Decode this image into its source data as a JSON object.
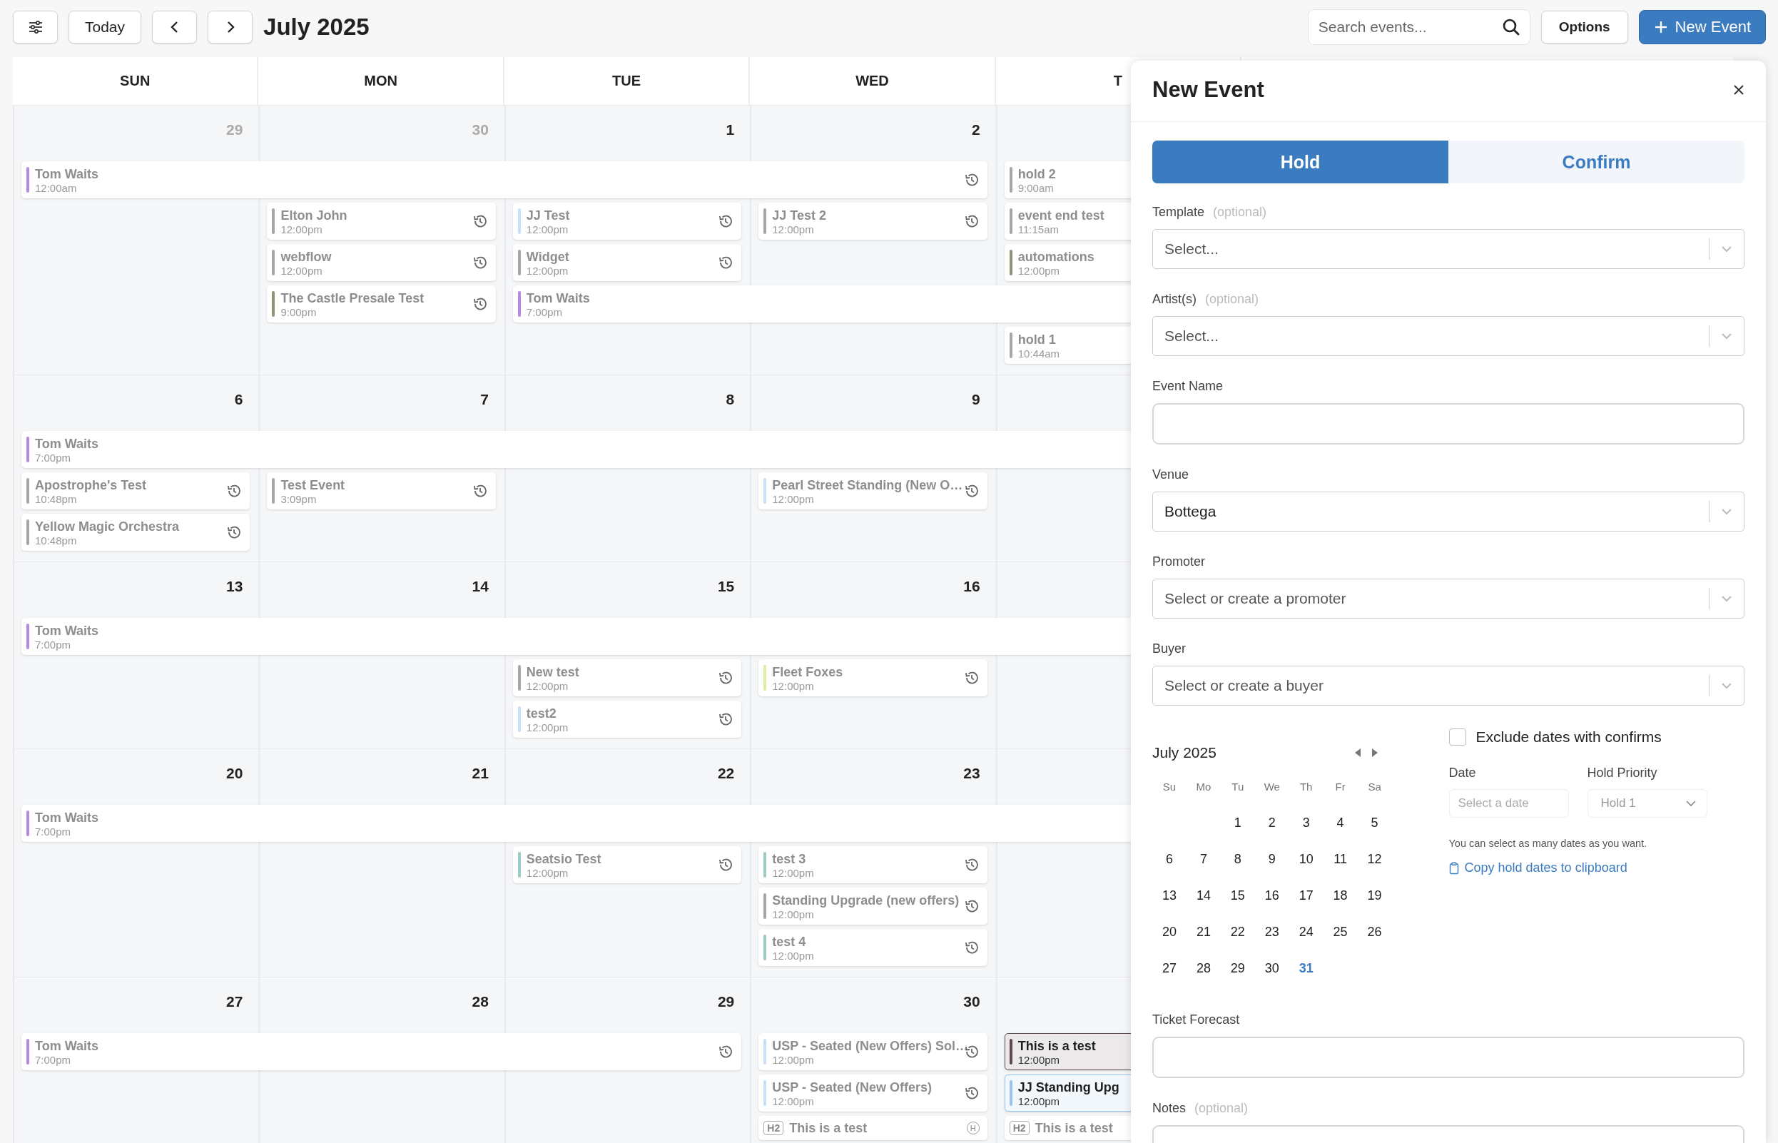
{
  "toolbar": {
    "today": "Today",
    "title": "July 2025",
    "search": {
      "placeholder": "Search events..."
    },
    "options": "Options",
    "new_event": "New Event"
  },
  "calendar": {
    "weekdays": [
      "SUN",
      "MON",
      "TUE",
      "WED",
      "T"
    ],
    "weeks": [
      {
        "days": [
          {
            "date": "29",
            "in_month": false
          },
          {
            "date": "30",
            "in_month": false
          },
          {
            "date": "1",
            "in_month": true
          },
          {
            "date": "2",
            "in_month": true
          }
        ],
        "lanes": [
          [
            {
              "kind": "hold",
              "title": "Tom Waits",
              "time": "12:00am",
              "color": "#b48be0",
              "history": true
            },
            {
              "kind": "continued"
            },
            {
              "kind": "continued"
            },
            {
              "kind": "continued"
            },
            {
              "kind": "hold",
              "title": "hold 2",
              "time": "9:00am",
              "color": "#a9a4a6",
              "history": false
            }
          ],
          [
            {
              "kind": "gap"
            },
            {
              "kind": "hold",
              "title": "Elton John",
              "time": "12:00pm",
              "color": "#a9a4a6",
              "history": true
            },
            {
              "kind": "hold",
              "title": "JJ Test",
              "time": "12:00pm",
              "color": "#c9defa",
              "history": true
            },
            {
              "kind": "hold",
              "title": "JJ Test 2",
              "time": "12:00pm",
              "color": "#a9a4a6",
              "history": true
            },
            {
              "kind": "hold",
              "title": "event end test",
              "time": "11:15am",
              "color": "#a9a4a6",
              "history": false
            }
          ],
          [
            {
              "kind": "gap"
            },
            {
              "kind": "hold",
              "title": "webflow",
              "time": "12:00pm",
              "color": "#a9a4a6",
              "history": true
            },
            {
              "kind": "hold",
              "title": "Widget",
              "time": "12:00pm",
              "color": "#a9a4a6",
              "history": true
            },
            {
              "kind": "gap"
            },
            {
              "kind": "hold",
              "title": "automations",
              "time": "12:00pm",
              "color": "#8f9474",
              "history": false
            }
          ],
          [
            {
              "kind": "gap"
            },
            {
              "kind": "hold",
              "title": "The Castle Presale Test",
              "time": "9:00pm",
              "color": "#8f9474",
              "history": true
            },
            {
              "kind": "hold",
              "title": "Tom Waits",
              "time": "7:00pm",
              "color": "#b48be0",
              "history": false
            },
            {
              "kind": "continued"
            },
            {
              "kind": "continued"
            },
            {
              "kind": "continued"
            },
            {
              "kind": "continued"
            }
          ],
          [
            {
              "kind": "gap"
            },
            {
              "kind": "gap"
            },
            {
              "kind": "gap"
            },
            {
              "kind": "gap"
            },
            {
              "kind": "hold",
              "title": "hold 1",
              "time": "10:44am",
              "color": "#a9a4a6",
              "history": false
            }
          ]
        ]
      },
      {
        "days": [
          {
            "date": "6",
            "in_month": true
          },
          {
            "date": "7",
            "in_month": true
          },
          {
            "date": "8",
            "in_month": true
          },
          {
            "date": "9",
            "in_month": true
          }
        ],
        "lanes": [
          [
            {
              "kind": "hold",
              "title": "Tom Waits",
              "time": "7:00pm",
              "color": "#b48be0",
              "history": false
            },
            {
              "kind": "continued"
            },
            {
              "kind": "continued"
            },
            {
              "kind": "continued"
            },
            {
              "kind": "continued"
            },
            {
              "kind": "continued"
            },
            {
              "kind": "continued"
            }
          ],
          [
            {
              "kind": "hold",
              "title": "Apostrophe's Test",
              "time": "10:48pm",
              "color": "#a9a4a6",
              "history": true
            },
            {
              "kind": "hold",
              "title": "Test Event",
              "time": "3:09pm",
              "color": "#a9a4a6",
              "history": true
            },
            {
              "kind": "gap"
            },
            {
              "kind": "hold",
              "title": "Pearl Street Standing (New O…",
              "time": "12:00pm",
              "color": "#c9defa",
              "history": true
            }
          ],
          [
            {
              "kind": "hold",
              "title": "Yellow Magic Orchestra",
              "time": "10:48pm",
              "color": "#a9a4a6",
              "history": true
            }
          ]
        ]
      },
      {
        "days": [
          {
            "date": "13",
            "in_month": true
          },
          {
            "date": "14",
            "in_month": true
          },
          {
            "date": "15",
            "in_month": true
          },
          {
            "date": "16",
            "in_month": true
          }
        ],
        "lanes": [
          [
            {
              "kind": "hold",
              "title": "Tom Waits",
              "time": "7:00pm",
              "color": "#b48be0",
              "history": false
            },
            {
              "kind": "continued"
            },
            {
              "kind": "continued"
            },
            {
              "kind": "continued"
            },
            {
              "kind": "continued"
            },
            {
              "kind": "continued"
            },
            {
              "kind": "continued"
            }
          ],
          [
            {
              "kind": "gap"
            },
            {
              "kind": "gap"
            },
            {
              "kind": "hold",
              "title": "New test",
              "time": "12:00pm",
              "color": "#a9a4a6",
              "history": true
            },
            {
              "kind": "hold",
              "title": "Fleet Foxes",
              "time": "12:00pm",
              "color": "#d8f0a0",
              "history": true
            }
          ],
          [
            {
              "kind": "gap"
            },
            {
              "kind": "gap"
            },
            {
              "kind": "hold",
              "title": "test2",
              "time": "12:00pm",
              "color": "#c9defa",
              "history": true
            }
          ]
        ]
      },
      {
        "days": [
          {
            "date": "20",
            "in_month": true
          },
          {
            "date": "21",
            "in_month": true
          },
          {
            "date": "22",
            "in_month": true
          },
          {
            "date": "23",
            "in_month": true
          }
        ],
        "lanes": [
          [
            {
              "kind": "hold",
              "title": "Tom Waits",
              "time": "7:00pm",
              "color": "#b48be0",
              "history": false
            },
            {
              "kind": "continued"
            },
            {
              "kind": "continued"
            },
            {
              "kind": "continued"
            },
            {
              "kind": "continued"
            },
            {
              "kind": "continued"
            },
            {
              "kind": "continued"
            }
          ],
          [
            {
              "kind": "gap"
            },
            {
              "kind": "gap"
            },
            {
              "kind": "hold",
              "title": "Seatsio Test",
              "time": "12:00pm",
              "color": "#9ccbc6",
              "history": true
            },
            {
              "kind": "hold",
              "title": "test 3",
              "time": "12:00pm",
              "color": "#9ccbc6",
              "history": true
            }
          ],
          [
            {
              "kind": "gap"
            },
            {
              "kind": "gap"
            },
            {
              "kind": "gap"
            },
            {
              "kind": "hold",
              "title": "Standing Upgrade (new offers)",
              "time": "12:00pm",
              "color": "#a9a4a6",
              "history": true
            }
          ],
          [
            {
              "kind": "gap"
            },
            {
              "kind": "gap"
            },
            {
              "kind": "gap"
            },
            {
              "kind": "hold",
              "title": "test 4",
              "time": "12:00pm",
              "color": "#9ccbc6",
              "history": true
            }
          ]
        ]
      },
      {
        "days": [
          {
            "date": "27",
            "in_month": true
          },
          {
            "date": "28",
            "in_month": true
          },
          {
            "date": "29",
            "in_month": true
          },
          {
            "date": "30",
            "in_month": true
          }
        ],
        "lanes": [
          [
            {
              "kind": "hold",
              "title": "Tom Waits",
              "time": "7:00pm",
              "color": "#b48be0",
              "history": true
            },
            {
              "kind": "continued"
            },
            {
              "kind": "continued"
            },
            {
              "kind": "hold",
              "title": "USP - Seated (New Offers) Sol…",
              "time": "12:00pm",
              "color": "#c9defa",
              "history": true
            },
            {
              "kind": "confirmed",
              "title": "This is a test",
              "time": "12:00pm",
              "color": "#5c4a4d",
              "history": false
            }
          ],
          [
            {
              "kind": "gap"
            },
            {
              "kind": "gap"
            },
            {
              "kind": "gap"
            },
            {
              "kind": "hold",
              "title": "USP - Seated (New Offers)",
              "time": "12:00pm",
              "color": "#c9defa",
              "history": true
            },
            {
              "kind": "confirmed",
              "title": "JJ Standing Upg",
              "time": "12:00pm",
              "color": "#9cc3f0",
              "history": false
            }
          ],
          [
            {
              "kind": "gap"
            },
            {
              "kind": "gap"
            },
            {
              "kind": "gap"
            },
            {
              "kind": "badge",
              "badge": "H2",
              "title": "This is a test",
              "end_mark": "H"
            },
            {
              "kind": "badge",
              "badge": "H2",
              "title": "This is a test"
            }
          ]
        ]
      }
    ]
  },
  "panel": {
    "title": "New Event",
    "mode_tabs": [
      {
        "label": "Hold",
        "selected": true
      },
      {
        "label": "Confirm",
        "selected": false
      }
    ],
    "fields": [
      {
        "kind": "select",
        "label": "Template",
        "optional": "(optional)",
        "placeholder": "Select..."
      },
      {
        "kind": "select",
        "label": "Artist(s)",
        "optional": "(optional)",
        "placeholder": "Select..."
      },
      {
        "kind": "text",
        "label": "Event Name"
      },
      {
        "kind": "select",
        "label": "Venue",
        "value": "Bottega"
      },
      {
        "kind": "select",
        "label": "Promoter",
        "placeholder": "Select or create a promoter"
      },
      {
        "kind": "select",
        "label": "Buyer",
        "placeholder": "Select or create a buyer"
      }
    ],
    "date_picker": {
      "month": "July 2025",
      "weekdays": [
        "Su",
        "Mo",
        "Tu",
        "We",
        "Th",
        "Fr",
        "Sa"
      ],
      "weeks": [
        [
          {
            "d": "1",
            "today": false
          },
          {
            "d": "2",
            "today": false
          },
          {
            "d": "3",
            "today": false
          },
          {
            "d": "4",
            "today": false
          },
          {
            "d": "5",
            "today": false
          }
        ],
        [
          {
            "d": "6",
            "today": false
          },
          {
            "d": "7",
            "today": false
          },
          {
            "d": "8",
            "today": false
          },
          {
            "d": "9",
            "today": false
          },
          {
            "d": "10",
            "today": false
          },
          {
            "d": "11",
            "today": false
          },
          {
            "d": "12",
            "today": false
          }
        ],
        [
          {
            "d": "13",
            "today": false
          },
          {
            "d": "14",
            "today": false
          },
          {
            "d": "15",
            "today": false
          },
          {
            "d": "16",
            "today": false
          },
          {
            "d": "17",
            "today": false
          },
          {
            "d": "18",
            "today": false
          },
          {
            "d": "19",
            "today": false
          }
        ],
        [
          {
            "d": "20",
            "today": false
          },
          {
            "d": "21",
            "today": false
          },
          {
            "d": "22",
            "today": false
          },
          {
            "d": "23",
            "today": false
          },
          {
            "d": "24",
            "today": false
          },
          {
            "d": "25",
            "today": false
          },
          {
            "d": "26",
            "today": false
          }
        ],
        [
          {
            "d": "27",
            "today": false
          },
          {
            "d": "28",
            "today": false
          },
          {
            "d": "29",
            "today": false
          },
          {
            "d": "30",
            "today": false
          },
          {
            "d": "31",
            "today": true
          }
        ]
      ]
    },
    "exclude_confirms": {
      "label": "Exclude dates with confirms",
      "checked": false
    },
    "date": {
      "label": "Date",
      "placeholder": "Select a date"
    },
    "hold_priority": {
      "label": "Hold Priority",
      "value": "Hold 1"
    },
    "hint": "You can select as many dates as you want.",
    "copy_link": "Copy hold dates to clipboard",
    "fields_after": [
      {
        "kind": "text",
        "label": "Ticket Forecast"
      },
      {
        "kind": "text",
        "label": "Notes",
        "optional": "(optional)"
      }
    ]
  }
}
